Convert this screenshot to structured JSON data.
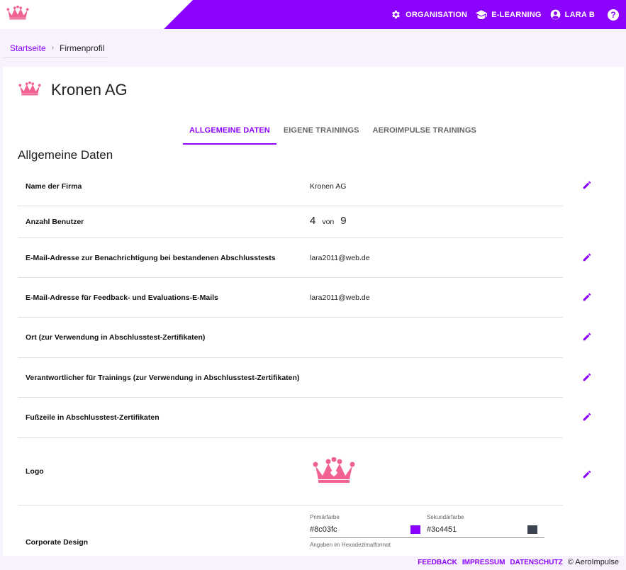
{
  "topbar": {
    "nav": [
      {
        "icon": "gear-icon",
        "label": "ORGANISATION"
      },
      {
        "icon": "school-icon",
        "label": "E-LEARNING"
      },
      {
        "icon": "account-icon",
        "label": "LARA B"
      }
    ],
    "help_label": "?"
  },
  "breadcrumb": {
    "home": "Startseite",
    "separator": "›",
    "current": "Firmenprofil"
  },
  "company": {
    "name": "Kronen AG"
  },
  "tabs": [
    "ALLGEMEINE DATEN",
    "EIGENE TRAININGS",
    "AEROIMPULSE TRAININGS"
  ],
  "section_title": "Allgemeine Daten",
  "rows": {
    "firm_name": {
      "label": "Name der Firma",
      "value": "Kronen AG"
    },
    "users": {
      "label": "Anzahl Benutzer",
      "current": "4",
      "von": "von",
      "max": "9"
    },
    "email_pass": {
      "label": "E-Mail-Adresse zur Benachrichtigung bei bestandenen Abschlusstests",
      "value": "lara2011@web.de"
    },
    "email_feedback": {
      "label": "E-Mail-Adresse für Feedback- und Evaluations-E-Mails",
      "value": "lara2011@web.de"
    },
    "city": {
      "label": "Ort (zur Verwendung in Abschlusstest-Zertifikaten)",
      "value": ""
    },
    "responsible": {
      "label": "Verantwortlicher für Trainings (zur Verwendung in Abschlusstest-Zertifikaten)",
      "value": ""
    },
    "footer_line": {
      "label": "Fußzeile in Abschlusstest-Zertifikaten",
      "value": ""
    },
    "logo": {
      "label": "Logo"
    },
    "corporate": {
      "label": "Corporate Design",
      "primary_label": "Primärfarbe",
      "primary_value": "#8c03fc",
      "secondary_label": "Sekundärfarbe",
      "secondary_value": "#3c4451",
      "hint": "Angaben im Hexadezimalformat"
    }
  },
  "footer": {
    "links": [
      "FEEDBACK",
      "IMPRESSUM",
      "DATENSCHUTZ"
    ],
    "copyright": "© AeroImpulse"
  },
  "colors": {
    "accent": "#8c03fc",
    "crown": "#f06292",
    "secondary": "#3c4451"
  }
}
